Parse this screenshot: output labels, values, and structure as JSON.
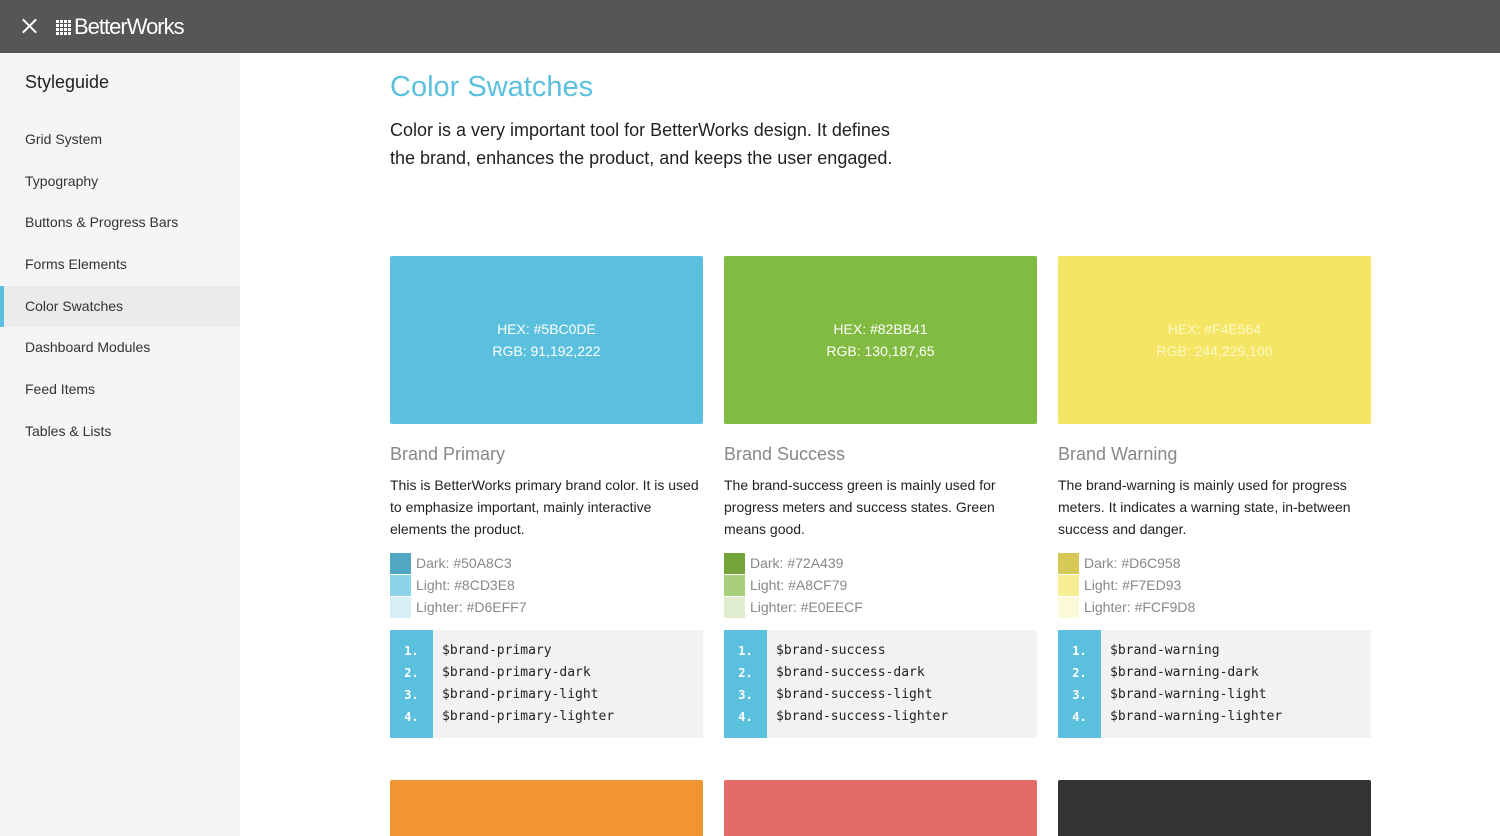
{
  "app": {
    "logo_text": "BetterWorks"
  },
  "sidebar": {
    "title": "Styleguide",
    "items": [
      {
        "label": "Grid System"
      },
      {
        "label": "Typography"
      },
      {
        "label": "Buttons & Progress Bars"
      },
      {
        "label": "Forms Elements"
      },
      {
        "label": "Color Swatches",
        "active": true
      },
      {
        "label": "Dashboard Modules"
      },
      {
        "label": "Feed Items"
      },
      {
        "label": "Tables & Lists"
      }
    ]
  },
  "main": {
    "title": "Color Swatches",
    "intro": "Color is a very important tool for BetterWorks design. It defines the brand, enhances the product, and keeps the user engaged.",
    "cards": [
      {
        "color": "#5BC0DE",
        "hex": "HEX: #5BC0DE",
        "rgb": "RGB: 91,192,222",
        "title": "Brand Primary",
        "description": "This is BetterWorks primary brand color. It is used to emphasize important, mainly interactive elements the product.",
        "shades": [
          {
            "label": "Dark: #50A8C3",
            "color": "#50A8C3"
          },
          {
            "label": "Light: #8CD3E8",
            "color": "#8CD3E8"
          },
          {
            "label": "Lighter: #D6EFF7",
            "color": "#D6EFF7"
          }
        ],
        "code_numbers": [
          "1.",
          "2.",
          "3.",
          "4."
        ],
        "code_lines": [
          "$brand-primary",
          "$brand-primary-dark",
          "$brand-primary-light",
          "$brand-primary-lighter"
        ]
      },
      {
        "color": "#82BB41",
        "hex": "HEX: #82BB41",
        "rgb": "RGB: 130,187,65",
        "title": "Brand Success",
        "description": "The brand-success green is mainly used for progress meters and success states. Green means good.",
        "shades": [
          {
            "label": "Dark: #72A439",
            "color": "#72A439"
          },
          {
            "label": "Light: #A8CF79",
            "color": "#A8CF79"
          },
          {
            "label": "Lighter: #E0EECF",
            "color": "#E0EECF"
          }
        ],
        "code_numbers": [
          "1.",
          "2.",
          "3.",
          "4."
        ],
        "code_lines": [
          "$brand-success",
          "$brand-success-dark",
          "$brand-success-light",
          "$brand-success-lighter"
        ]
      },
      {
        "color": "#F4E564",
        "hex": "HEX: #F4E564",
        "rgb": "RGB: 244,229,100",
        "title": "Brand Warning",
        "description": "The brand-warning is mainly used for progress meters. It indicates a warning state, in-between success and danger.",
        "shades": [
          {
            "label": "Dark: #D6C958",
            "color": "#D6C958"
          },
          {
            "label": "Light: #F7ED93",
            "color": "#F7ED93"
          },
          {
            "label": "Lighter: #FCF9D8",
            "color": "#FCF9D8"
          }
        ],
        "code_numbers": [
          "1.",
          "2.",
          "3.",
          "4."
        ],
        "code_lines": [
          "$brand-warning",
          "$brand-warning-dark",
          "$brand-warning-light",
          "$brand-warning-lighter"
        ]
      }
    ],
    "next_row_colors": [
      "#F19432",
      "#E46B67",
      "#333333"
    ]
  }
}
